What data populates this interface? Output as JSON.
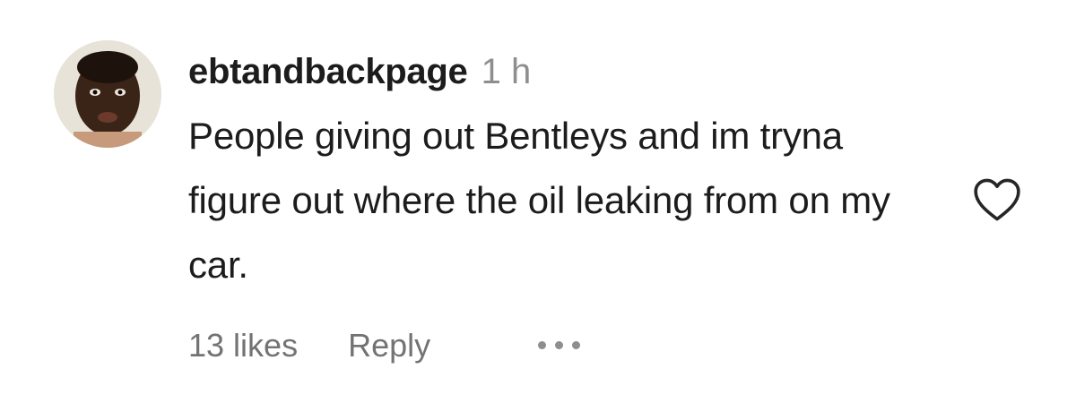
{
  "comment": {
    "username": "ebtandbackpage",
    "timestamp": "1 h",
    "text": "People giving out Bentleys and im tryna figure out where the oil leaking from on my car.",
    "likes_label": "13 likes",
    "reply_label": "Reply",
    "more_icon": "ellipsis-icon",
    "like_icon": "heart-outline-icon",
    "avatar_icon": "user-avatar"
  },
  "colors": {
    "text": "#1c1c1c",
    "secondary": "#8e8e8e",
    "action": "#737373",
    "background": "#ffffff"
  }
}
